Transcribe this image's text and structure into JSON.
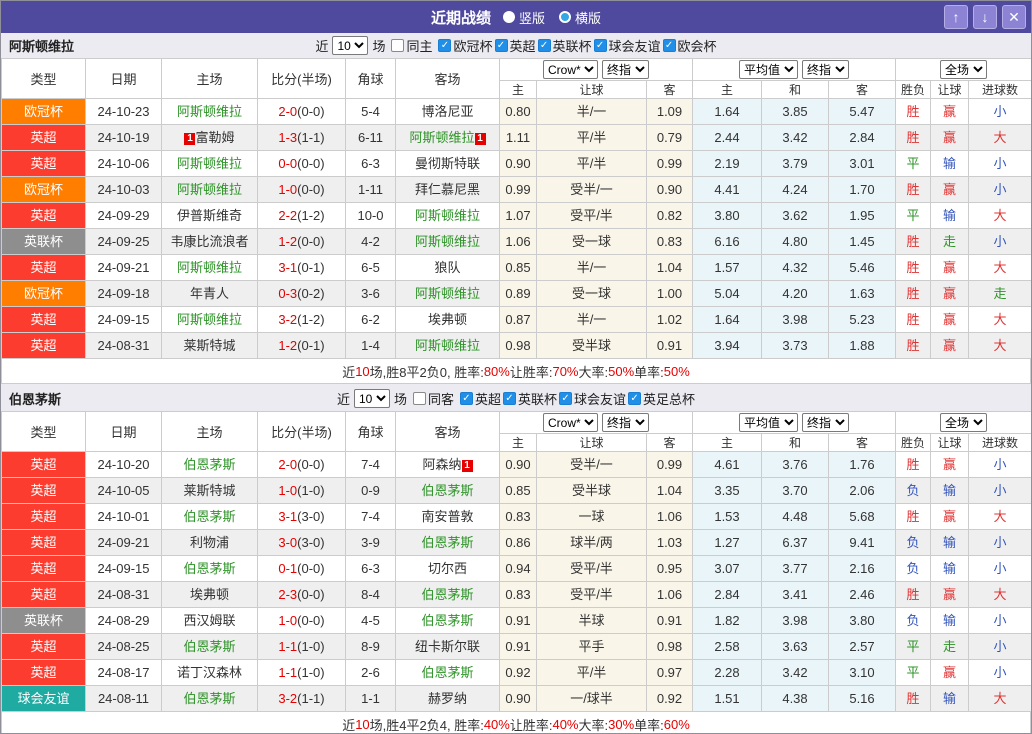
{
  "titlebar": {
    "title": "近期战绩",
    "radios": [
      {
        "label": "竖版",
        "selected": true
      },
      {
        "label": "横版",
        "selected": false
      }
    ],
    "buttons": [
      {
        "name": "scroll-up",
        "glyph": "↑"
      },
      {
        "name": "scroll-down",
        "glyph": "↓"
      },
      {
        "name": "close",
        "glyph": "✕"
      }
    ]
  },
  "table_columns": {
    "type": "类型",
    "date": "日期",
    "home": "主场",
    "score": "比分(半场)",
    "corner": "角球",
    "away": "客场",
    "crow": "Crow*",
    "final": "终指",
    "avg": "平均值",
    "scope": "全场",
    "sub_home": "主",
    "sub_handicap": "让球",
    "sub_away": "客",
    "sub_draw": "和",
    "sub_result": "胜负",
    "sub_goals": "进球数"
  },
  "colors": {
    "titlebar_bg": "#4f4a9e",
    "league_orange": "#ff7e00",
    "league_red": "#fb3c2f",
    "league_gray": "#8e8e8e",
    "league_teal": "#1faaa2",
    "highlight_green": "#2d9327",
    "score_red": "#e60000",
    "win_red": "#e13333",
    "lose_blue": "#3355bb",
    "handicap_bg": "#faf5e9",
    "avg_bg": "#eaf5fa"
  },
  "sections": [
    {
      "team": "阿斯顿维拉",
      "filter": {
        "prefix": "近",
        "count": "10",
        "suffix": "场",
        "same_side": {
          "label": "同主",
          "checked": false
        },
        "leagues": [
          {
            "label": "欧冠杯",
            "checked": true
          },
          {
            "label": "英超",
            "checked": true
          },
          {
            "label": "英联杯",
            "checked": true
          },
          {
            "label": "球会友谊",
            "checked": true
          },
          {
            "label": "欧会杯",
            "checked": true
          }
        ]
      },
      "rows": [
        {
          "lg": "欧冠杯",
          "lc": "orange",
          "date": "24-10-23",
          "home": "阿斯顿维拉",
          "hh": 1,
          "hb": "",
          "score": "2-0",
          "half": "(0-0)",
          "corner": "5-4",
          "away": "博洛尼亚",
          "ah": 0,
          "ab": "",
          "h1": "0.80",
          "hc": "半/一",
          "h2": "1.09",
          "m1": "1.64",
          "m2": "3.85",
          "m3": "5.47",
          "r": "胜",
          "rc": "r",
          "l": "赢",
          "lcl": "r",
          "g": "小",
          "gc": "b"
        },
        {
          "lg": "英超",
          "lc": "red",
          "date": "24-10-19",
          "home": "富勒姆",
          "hh": 0,
          "hb": "1",
          "score": "1-3",
          "half": "(1-1)",
          "corner": "6-11",
          "away": "阿斯顿维拉",
          "ah": 1,
          "ab": "1",
          "h1": "1.11",
          "hc": "平/半",
          "h2": "0.79",
          "m1": "2.44",
          "m2": "3.42",
          "m3": "2.84",
          "r": "胜",
          "rc": "r",
          "l": "赢",
          "lcl": "r",
          "g": "大",
          "gc": "r"
        },
        {
          "lg": "英超",
          "lc": "red",
          "date": "24-10-06",
          "home": "阿斯顿维拉",
          "hh": 1,
          "hb": "",
          "score": "0-0",
          "half": "(0-0)",
          "corner": "6-3",
          "away": "曼彻斯特联",
          "ah": 0,
          "ab": "",
          "h1": "0.90",
          "hc": "平/半",
          "h2": "0.99",
          "m1": "2.19",
          "m2": "3.79",
          "m3": "3.01",
          "r": "平",
          "rc": "g",
          "l": "输",
          "lcl": "b",
          "g": "小",
          "gc": "b"
        },
        {
          "lg": "欧冠杯",
          "lc": "orange",
          "date": "24-10-03",
          "home": "阿斯顿维拉",
          "hh": 1,
          "hb": "",
          "score": "1-0",
          "half": "(0-0)",
          "corner": "1-11",
          "away": "拜仁慕尼黑",
          "ah": 0,
          "ab": "",
          "h1": "0.99",
          "hc": "受半/一",
          "h2": "0.90",
          "m1": "4.41",
          "m2": "4.24",
          "m3": "1.70",
          "r": "胜",
          "rc": "r",
          "l": "赢",
          "lcl": "r",
          "g": "小",
          "gc": "b"
        },
        {
          "lg": "英超",
          "lc": "red",
          "date": "24-09-29",
          "home": "伊普斯维奇",
          "hh": 0,
          "hb": "",
          "score": "2-2",
          "half": "(1-2)",
          "corner": "10-0",
          "away": "阿斯顿维拉",
          "ah": 1,
          "ab": "",
          "h1": "1.07",
          "hc": "受平/半",
          "h2": "0.82",
          "m1": "3.80",
          "m2": "3.62",
          "m3": "1.95",
          "r": "平",
          "rc": "g",
          "l": "输",
          "lcl": "b",
          "g": "大",
          "gc": "r"
        },
        {
          "lg": "英联杯",
          "lc": "gray",
          "date": "24-09-25",
          "home": "韦康比流浪者",
          "hh": 0,
          "hb": "",
          "score": "1-2",
          "half": "(0-0)",
          "corner": "4-2",
          "away": "阿斯顿维拉",
          "ah": 1,
          "ab": "",
          "h1": "1.06",
          "hc": "受一球",
          "h2": "0.83",
          "m1": "6.16",
          "m2": "4.80",
          "m3": "1.45",
          "r": "胜",
          "rc": "r",
          "l": "走",
          "lcl": "g",
          "g": "小",
          "gc": "b"
        },
        {
          "lg": "英超",
          "lc": "red",
          "date": "24-09-21",
          "home": "阿斯顿维拉",
          "hh": 1,
          "hb": "",
          "score": "3-1",
          "half": "(0-1)",
          "corner": "6-5",
          "away": "狼队",
          "ah": 0,
          "ab": "",
          "h1": "0.85",
          "hc": "半/一",
          "h2": "1.04",
          "m1": "1.57",
          "m2": "4.32",
          "m3": "5.46",
          "r": "胜",
          "rc": "r",
          "l": "赢",
          "lcl": "r",
          "g": "大",
          "gc": "r"
        },
        {
          "lg": "欧冠杯",
          "lc": "orange",
          "date": "24-09-18",
          "home": "年青人",
          "hh": 0,
          "hb": "",
          "score": "0-3",
          "half": "(0-2)",
          "corner": "3-6",
          "away": "阿斯顿维拉",
          "ah": 1,
          "ab": "",
          "h1": "0.89",
          "hc": "受一球",
          "h2": "1.00",
          "m1": "5.04",
          "m2": "4.20",
          "m3": "1.63",
          "r": "胜",
          "rc": "r",
          "l": "赢",
          "lcl": "r",
          "g": "走",
          "gc": "g"
        },
        {
          "lg": "英超",
          "lc": "red",
          "date": "24-09-15",
          "home": "阿斯顿维拉",
          "hh": 1,
          "hb": "",
          "score": "3-2",
          "half": "(1-2)",
          "corner": "6-2",
          "away": "埃弗顿",
          "ah": 0,
          "ab": "",
          "h1": "0.87",
          "hc": "半/一",
          "h2": "1.02",
          "m1": "1.64",
          "m2": "3.98",
          "m3": "5.23",
          "r": "胜",
          "rc": "r",
          "l": "赢",
          "lcl": "r",
          "g": "大",
          "gc": "r"
        },
        {
          "lg": "英超",
          "lc": "red",
          "date": "24-08-31",
          "home": "莱斯特城",
          "hh": 0,
          "hb": "",
          "score": "1-2",
          "half": "(0-1)",
          "corner": "1-4",
          "away": "阿斯顿维拉",
          "ah": 1,
          "ab": "",
          "h1": "0.98",
          "hc": "受半球",
          "h2": "0.91",
          "m1": "3.94",
          "m2": "3.73",
          "m3": "1.88",
          "r": "胜",
          "rc": "r",
          "l": "赢",
          "lcl": "r",
          "g": "大",
          "gc": "r"
        }
      ],
      "summary": [
        {
          "t": "近",
          "c": "k"
        },
        {
          "t": "10",
          "c": "r"
        },
        {
          "t": "场,胜8平2负0, 胜率:",
          "c": "k"
        },
        {
          "t": "80%",
          "c": "r"
        },
        {
          "t": " 让胜率:",
          "c": "k"
        },
        {
          "t": "70%",
          "c": "r"
        },
        {
          "t": " 大率:",
          "c": "k"
        },
        {
          "t": "50%",
          "c": "r"
        },
        {
          "t": " 单率:",
          "c": "k"
        },
        {
          "t": "50%",
          "c": "r"
        }
      ]
    },
    {
      "team": "伯恩茅斯",
      "filter": {
        "prefix": "近",
        "count": "10",
        "suffix": "场",
        "same_side": {
          "label": "同客",
          "checked": false
        },
        "leagues": [
          {
            "label": "英超",
            "checked": true
          },
          {
            "label": "英联杯",
            "checked": true
          },
          {
            "label": "球会友谊",
            "checked": true
          },
          {
            "label": "英足总杯",
            "checked": true
          }
        ]
      },
      "rows": [
        {
          "lg": "英超",
          "lc": "red",
          "date": "24-10-20",
          "home": "伯恩茅斯",
          "hh": 1,
          "hb": "",
          "score": "2-0",
          "half": "(0-0)",
          "corner": "7-4",
          "away": "阿森纳",
          "ah": 0,
          "ab": "1",
          "h1": "0.90",
          "hc": "受半/一",
          "h2": "0.99",
          "m1": "4.61",
          "m2": "3.76",
          "m3": "1.76",
          "r": "胜",
          "rc": "r",
          "l": "赢",
          "lcl": "r",
          "g": "小",
          "gc": "b"
        },
        {
          "lg": "英超",
          "lc": "red",
          "date": "24-10-05",
          "home": "莱斯特城",
          "hh": 0,
          "hb": "",
          "score": "1-0",
          "half": "(1-0)",
          "corner": "0-9",
          "away": "伯恩茅斯",
          "ah": 1,
          "ab": "",
          "h1": "0.85",
          "hc": "受半球",
          "h2": "1.04",
          "m1": "3.35",
          "m2": "3.70",
          "m3": "2.06",
          "r": "负",
          "rc": "b",
          "l": "输",
          "lcl": "b",
          "g": "小",
          "gc": "b"
        },
        {
          "lg": "英超",
          "lc": "red",
          "date": "24-10-01",
          "home": "伯恩茅斯",
          "hh": 1,
          "hb": "",
          "score": "3-1",
          "half": "(3-0)",
          "corner": "7-4",
          "away": "南安普敦",
          "ah": 0,
          "ab": "",
          "h1": "0.83",
          "hc": "一球",
          "h2": "1.06",
          "m1": "1.53",
          "m2": "4.48",
          "m3": "5.68",
          "r": "胜",
          "rc": "r",
          "l": "赢",
          "lcl": "r",
          "g": "大",
          "gc": "r"
        },
        {
          "lg": "英超",
          "lc": "red",
          "date": "24-09-21",
          "home": "利物浦",
          "hh": 0,
          "hb": "",
          "score": "3-0",
          "half": "(3-0)",
          "corner": "3-9",
          "away": "伯恩茅斯",
          "ah": 1,
          "ab": "",
          "h1": "0.86",
          "hc": "球半/两",
          "h2": "1.03",
          "m1": "1.27",
          "m2": "6.37",
          "m3": "9.41",
          "r": "负",
          "rc": "b",
          "l": "输",
          "lcl": "b",
          "g": "小",
          "gc": "b"
        },
        {
          "lg": "英超",
          "lc": "red",
          "date": "24-09-15",
          "home": "伯恩茅斯",
          "hh": 1,
          "hb": "",
          "score": "0-1",
          "half": "(0-0)",
          "corner": "6-3",
          "away": "切尔西",
          "ah": 0,
          "ab": "",
          "h1": "0.94",
          "hc": "受平/半",
          "h2": "0.95",
          "m1": "3.07",
          "m2": "3.77",
          "m3": "2.16",
          "r": "负",
          "rc": "b",
          "l": "输",
          "lcl": "b",
          "g": "小",
          "gc": "b"
        },
        {
          "lg": "英超",
          "lc": "red",
          "date": "24-08-31",
          "home": "埃弗顿",
          "hh": 0,
          "hb": "",
          "score": "2-3",
          "half": "(0-0)",
          "corner": "8-4",
          "away": "伯恩茅斯",
          "ah": 1,
          "ab": "",
          "h1": "0.83",
          "hc": "受平/半",
          "h2": "1.06",
          "m1": "2.84",
          "m2": "3.41",
          "m3": "2.46",
          "r": "胜",
          "rc": "r",
          "l": "赢",
          "lcl": "r",
          "g": "大",
          "gc": "r"
        },
        {
          "lg": "英联杯",
          "lc": "gray",
          "date": "24-08-29",
          "home": "西汉姆联",
          "hh": 0,
          "hb": "",
          "score": "1-0",
          "half": "(0-0)",
          "corner": "4-5",
          "away": "伯恩茅斯",
          "ah": 1,
          "ab": "",
          "h1": "0.91",
          "hc": "半球",
          "h2": "0.91",
          "m1": "1.82",
          "m2": "3.98",
          "m3": "3.80",
          "r": "负",
          "rc": "b",
          "l": "输",
          "lcl": "b",
          "g": "小",
          "gc": "b"
        },
        {
          "lg": "英超",
          "lc": "red",
          "date": "24-08-25",
          "home": "伯恩茅斯",
          "hh": 1,
          "hb": "",
          "score": "1-1",
          "half": "(1-0)",
          "corner": "8-9",
          "away": "纽卡斯尔联",
          "ah": 0,
          "ab": "",
          "h1": "0.91",
          "hc": "平手",
          "h2": "0.98",
          "m1": "2.58",
          "m2": "3.63",
          "m3": "2.57",
          "r": "平",
          "rc": "g",
          "l": "走",
          "lcl": "g",
          "g": "小",
          "gc": "b"
        },
        {
          "lg": "英超",
          "lc": "red",
          "date": "24-08-17",
          "home": "诺丁汉森林",
          "hh": 0,
          "hb": "",
          "score": "1-1",
          "half": "(1-0)",
          "corner": "2-6",
          "away": "伯恩茅斯",
          "ah": 1,
          "ab": "",
          "h1": "0.92",
          "hc": "平/半",
          "h2": "0.97",
          "m1": "2.28",
          "m2": "3.42",
          "m3": "3.10",
          "r": "平",
          "rc": "g",
          "l": "赢",
          "lcl": "r",
          "g": "小",
          "gc": "b"
        },
        {
          "lg": "球会友谊",
          "lc": "teal",
          "date": "24-08-11",
          "home": "伯恩茅斯",
          "hh": 1,
          "hb": "",
          "score": "3-2",
          "half": "(1-1)",
          "corner": "1-1",
          "away": "赫罗纳",
          "ah": 0,
          "ab": "",
          "h1": "0.90",
          "hc": "一/球半",
          "h2": "0.92",
          "m1": "1.51",
          "m2": "4.38",
          "m3": "5.16",
          "r": "胜",
          "rc": "r",
          "l": "输",
          "lcl": "b",
          "g": "大",
          "gc": "r"
        }
      ],
      "summary": [
        {
          "t": "近",
          "c": "k"
        },
        {
          "t": "10",
          "c": "r"
        },
        {
          "t": "场,胜4平2负4, 胜率:",
          "c": "k"
        },
        {
          "t": "40%",
          "c": "r"
        },
        {
          "t": " 让胜率:",
          "c": "k"
        },
        {
          "t": "40%",
          "c": "r"
        },
        {
          "t": " 大率:",
          "c": "k"
        },
        {
          "t": "30%",
          "c": "r"
        },
        {
          "t": " 单率:",
          "c": "k"
        },
        {
          "t": "60%",
          "c": "r"
        }
      ]
    }
  ]
}
